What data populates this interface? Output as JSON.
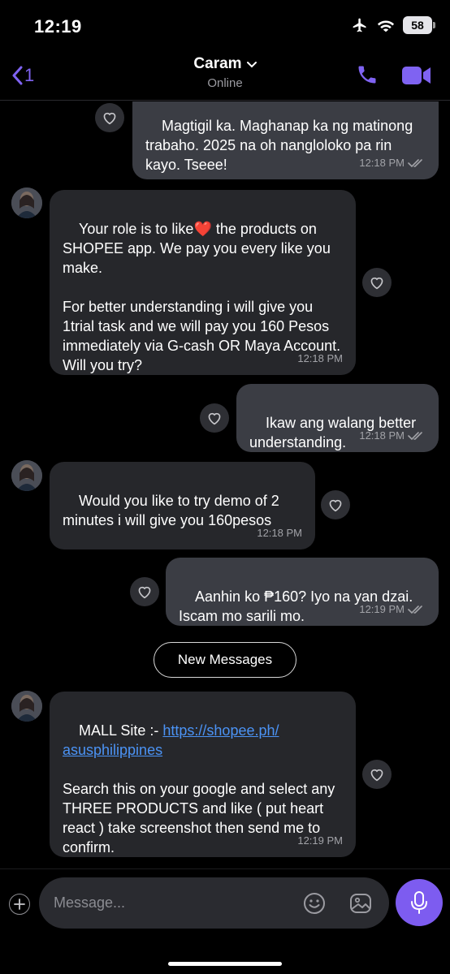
{
  "status_bar": {
    "time": "12:19",
    "battery": "58"
  },
  "header": {
    "back_count": "1",
    "contact_name": "Caram",
    "contact_status": "Online"
  },
  "messages": [
    {
      "direction": "outgoing",
      "text": "Magtigil ka. Maghanap ka ng matinong trabaho. 2025 na oh nangloloko pa rin kayo. Tseee!",
      "time": "12:18 PM"
    },
    {
      "direction": "incoming",
      "text_before_heart": "Your role is to like",
      "text_after_heart": " the products on SHOPEE app. We pay you every like you make.\n\nFor better understanding i will give you 1trial task and we will pay you 160 Pesos immediately via G-cash OR Maya Account. Will you try?",
      "time": "12:18 PM"
    },
    {
      "direction": "outgoing",
      "text": "Ikaw ang walang better understanding.",
      "time": "12:18 PM"
    },
    {
      "direction": "incoming",
      "text": "Would you like to try demo of 2 minutes i will give you 160pesos",
      "time": "12:18 PM"
    },
    {
      "direction": "outgoing",
      "text": "Aanhin ko ₱160? Iyo na yan dzai. Iscam mo sarili mo.",
      "time": "12:19 PM"
    },
    {
      "direction": "incoming",
      "prefix": "MALL Site :- ",
      "link_line1": "https://shopee.ph/",
      "link_line2": "asusphilippines",
      "text": "Search this on your google and select any THREE PRODUCTS and like ( put heart react ) take screenshot then send me to confirm.",
      "time": "12:19 PM"
    }
  ],
  "new_messages_label": "New Messages",
  "composer": {
    "placeholder": "Message..."
  },
  "colors": {
    "accent": "#7d5cf0",
    "incoming_bubble": "#26272b",
    "outgoing_bubble": "#3b3d44",
    "link": "#4b93f5"
  }
}
